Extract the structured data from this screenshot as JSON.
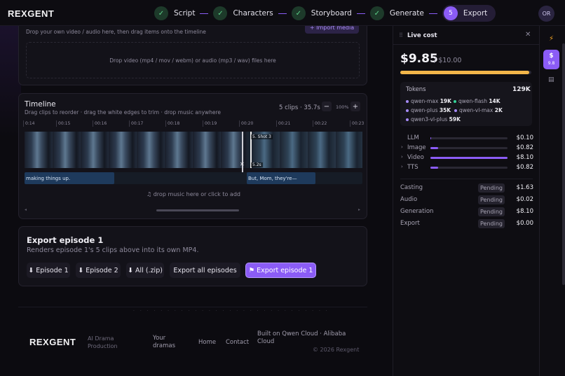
{
  "header": {
    "logo": "REXGENT",
    "steps": [
      {
        "label": "Script",
        "marker": "✓"
      },
      {
        "label": "Characters",
        "marker": "✓"
      },
      {
        "label": "Storyboard",
        "marker": "✓"
      },
      {
        "label": "Generate",
        "marker": "✓"
      },
      {
        "label": "Export",
        "marker": "5"
      }
    ],
    "avatar": "OR"
  },
  "media": {
    "hint": "Drop your own video / audio here, then drag items onto the timeline",
    "import_label": "+ Import media",
    "dropzone": "Drop video (mp4 / mov / webm) or audio (mp3 / wav) files here"
  },
  "timeline": {
    "title": "Timeline",
    "subtitle": "Drag clips to reorder · drag the white edges to trim · drop music anywhere",
    "meta": "5 clips · 35.7s",
    "zoom_out": "−",
    "zoom_level": "100%",
    "zoom_in": "+",
    "ticks": [
      "0:14",
      "00:15",
      "00:16",
      "00:17",
      "00:18",
      "00:19",
      "00:20",
      "00:21",
      "00:22",
      "00:23"
    ],
    "shot_label": "5. Shot 3",
    "shot_duration": "5.2s",
    "remove_icon": "✕",
    "subtitles": [
      "making things up.",
      "But, Mom, they're—"
    ],
    "music_hint": "♫ drop music here or click to add",
    "scroll_left": "◂",
    "scroll_right": "▸"
  },
  "export": {
    "title": "Export episode 1",
    "subtitle": "Renders episode 1's 5 clips above into its own MP4.",
    "buttons": [
      "⬇ Episode 1",
      "⬇ Episode 2",
      "⬇ All (.zip)",
      "Export all episodes",
      "⚑ Export episode 1"
    ]
  },
  "footer": {
    "logo": "REXGENT",
    "tagline": "AI Drama Production",
    "links": [
      "Your dramas",
      "Home",
      "Contact"
    ],
    "built": "Built on Qwen Cloud · Alibaba Cloud",
    "copyright": "© 2026 Rexgent",
    "dots": "· · · · · · · · · · · · · · · · · · · · · · · · · · · · ·"
  },
  "cost_panel": {
    "grip": "⠿",
    "title": "Live cost",
    "close": "✕",
    "spent": "$9.85",
    "cap": "/ $10.00",
    "spent_ratio": 0.985,
    "tokens_label": "Tokens",
    "tokens_total": "129K",
    "token_models": [
      {
        "name": "qwen-max",
        "value": "19K",
        "color": "#a78bfa"
      },
      {
        "name": "qwen-flash",
        "value": "14K",
        "color": "#34d399"
      },
      {
        "name": "qwen-plus",
        "value": "35K",
        "color": "#a78bfa"
      },
      {
        "name": "qwen-vl-max",
        "value": "2K",
        "color": "#a78bfa"
      },
      {
        "name": "qwen3-vl-plus",
        "value": "59K",
        "color": "#a78bfa"
      }
    ],
    "breakdown": [
      {
        "name": "LLM",
        "value": "$0.10",
        "chev": "",
        "fill": 0.01
      },
      {
        "name": "Image",
        "value": "$0.82",
        "chev": "›",
        "fill": 0.1
      },
      {
        "name": "Video",
        "value": "$8.10",
        "chev": "›",
        "fill": 1.0
      },
      {
        "name": "TTS",
        "value": "$0.82",
        "chev": "›",
        "fill": 0.1
      }
    ],
    "stages": [
      {
        "name": "Casting",
        "status": "Pending",
        "value": "$1.63"
      },
      {
        "name": "Audio",
        "status": "Pending",
        "value": "$0.02"
      },
      {
        "name": "Generation",
        "status": "Pending",
        "value": "$8.10"
      },
      {
        "name": "Export",
        "status": "Pending",
        "value": "$0.00"
      }
    ]
  },
  "rail": {
    "bolt": "⚡",
    "dollar": "$",
    "dollar_value": "9.8",
    "doc": "▤"
  },
  "colors": {
    "accent": "#8b5cf6",
    "budget_bar": "#f2b64a",
    "check": "#5fd38b"
  }
}
